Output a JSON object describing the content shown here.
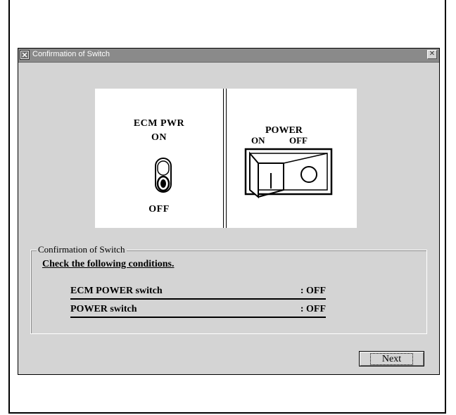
{
  "window": {
    "title": "Confirmation of Switch",
    "close_glyph": "✕"
  },
  "illustration": {
    "ecm_title": "ECM PWR",
    "ecm_on": "ON",
    "ecm_off": "OFF",
    "power_title": "POWER",
    "power_on": "ON",
    "power_off": "OFF"
  },
  "group": {
    "legend": "Confirmation of Switch",
    "heading": "Check the following conditions.",
    "conditions": [
      {
        "name": "ECM POWER switch",
        "value": ": OFF"
      },
      {
        "name": "POWER switch",
        "value": ": OFF"
      }
    ]
  },
  "buttons": {
    "next_label": "Next"
  },
  "icons": {
    "app": "app-icon",
    "close": "close-icon",
    "toggle": "toggle-switch-icon",
    "rocker": "rocker-switch-icon"
  }
}
